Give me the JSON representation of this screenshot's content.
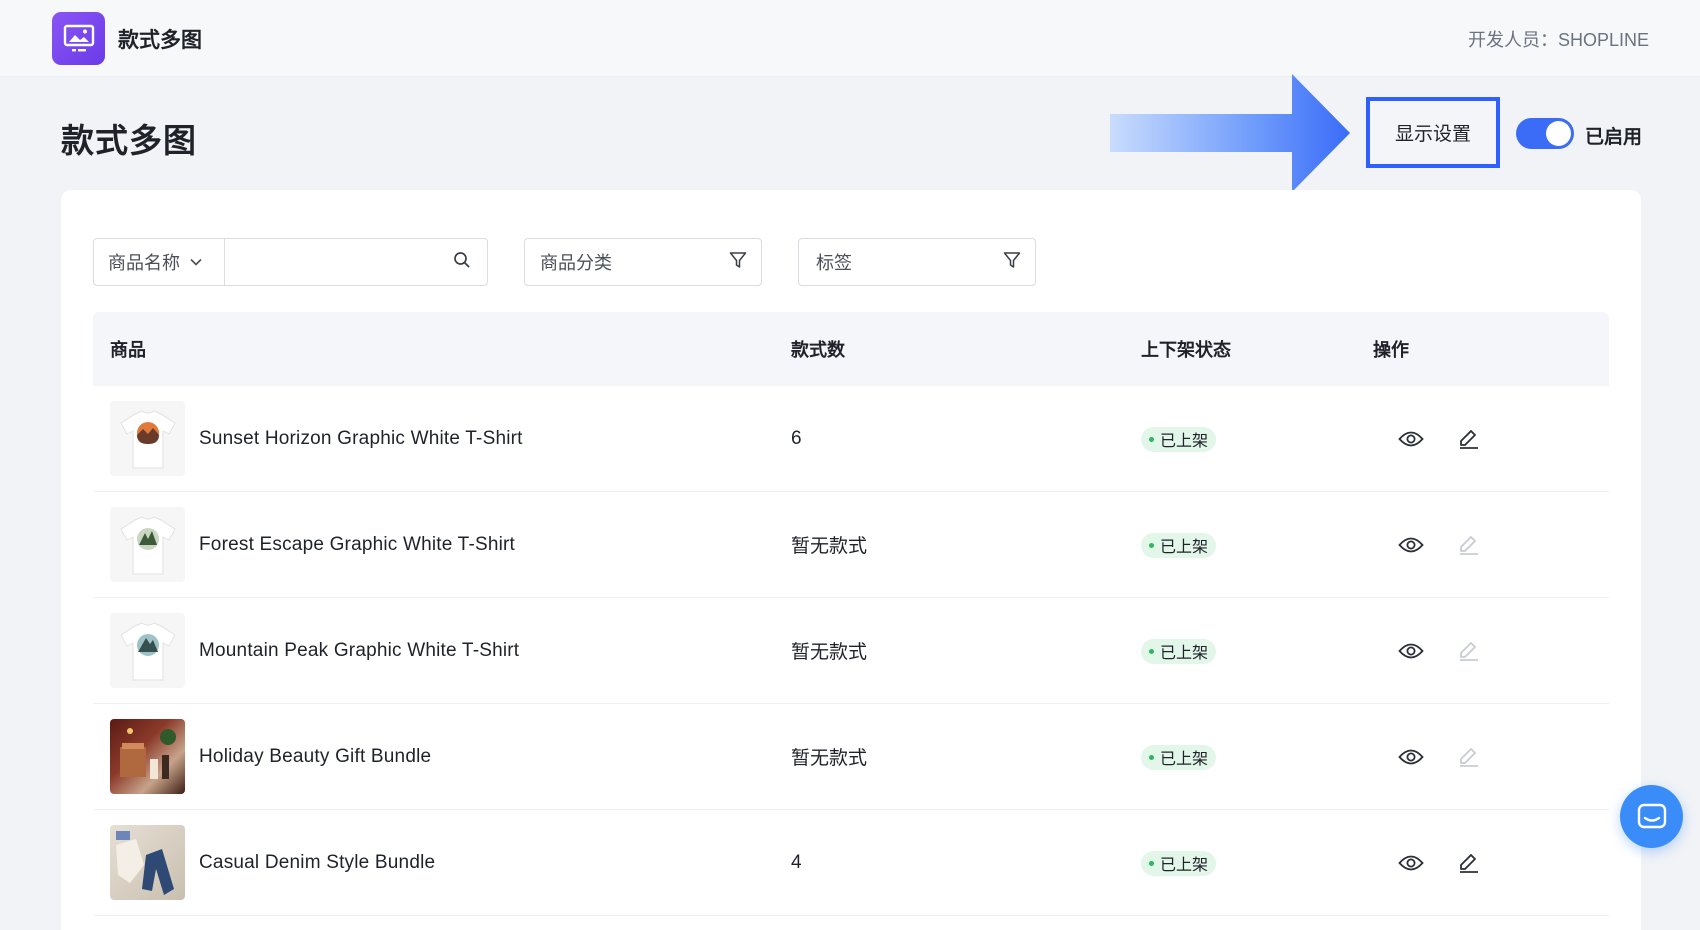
{
  "topbar": {
    "app_name": "款式多图",
    "developer": "开发人员：SHOPLINE"
  },
  "header": {
    "page_title": "款式多图",
    "display_settings_label": "显示设置",
    "toggle_label": "已启用",
    "toggle_on": true
  },
  "filters": {
    "field_select_label": "商品名称",
    "search_value": "",
    "category_label": "商品分类",
    "tag_label": "标签"
  },
  "table": {
    "columns": [
      "商品",
      "款式数",
      "上下架状态",
      "操作"
    ],
    "rows": [
      {
        "name": "Sunset Horizon Graphic White T-Shirt",
        "count": "6",
        "status": "已上架",
        "edit_enabled": true
      },
      {
        "name": "Forest Escape Graphic White T-Shirt",
        "count": "暂无款式",
        "status": "已上架",
        "edit_enabled": false
      },
      {
        "name": "Mountain Peak Graphic White T-Shirt",
        "count": "暂无款式",
        "status": "已上架",
        "edit_enabled": false
      },
      {
        "name": "Holiday Beauty Gift Bundle",
        "count": "暂无款式",
        "status": "已上架",
        "edit_enabled": false
      },
      {
        "name": "Casual Denim Style Bundle",
        "count": "4",
        "status": "已上架",
        "edit_enabled": true
      }
    ]
  },
  "colors": {
    "accent": "#3b6cf7",
    "highlight_border": "#2f5fff",
    "status_green": "#2fb55d",
    "logo_purple": "#7c4af0"
  },
  "icons": [
    "app-logo-icon",
    "chevron-down-icon",
    "search-icon",
    "filter-icon",
    "eye-icon",
    "edit-icon",
    "chat-icon",
    "arrow-right-icon"
  ]
}
